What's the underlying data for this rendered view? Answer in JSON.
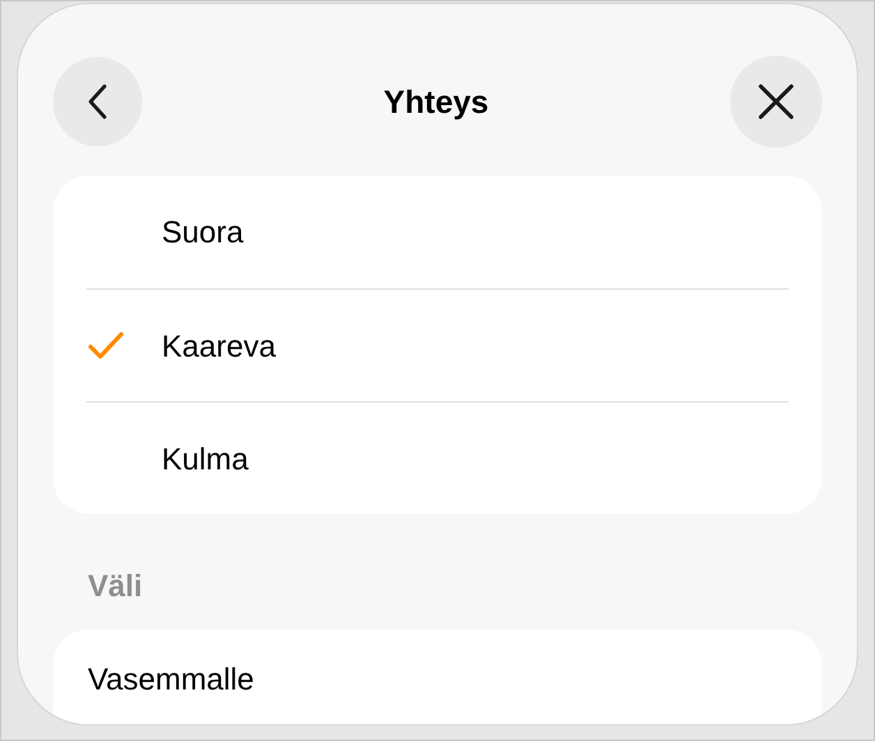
{
  "header": {
    "title": "Yhteys"
  },
  "options": [
    {
      "label": "Suora",
      "selected": false
    },
    {
      "label": "Kaareva",
      "selected": true
    },
    {
      "label": "Kulma",
      "selected": false
    }
  ],
  "spacing_section": {
    "heading": "Väli",
    "rows": [
      {
        "label": "Vasemmalle"
      }
    ]
  }
}
